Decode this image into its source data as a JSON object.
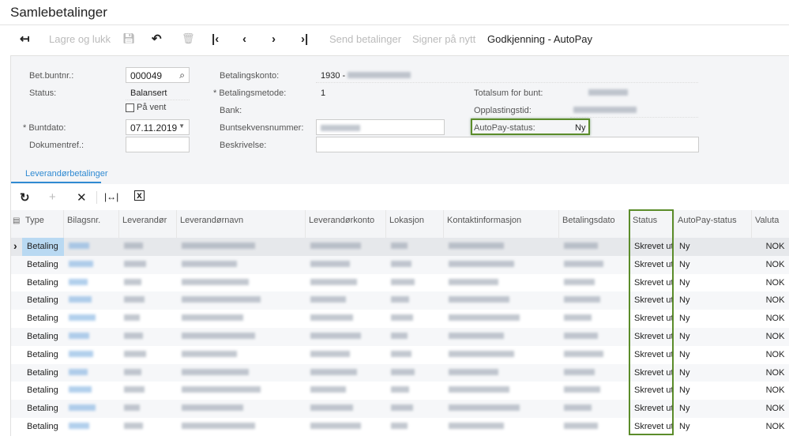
{
  "title": "Samlebetalinger",
  "toolbar": {
    "save_close": "Lagre og lukk",
    "send": "Send betalinger",
    "sign": "Signer på nytt",
    "approve": "Godkjenning - AutoPay"
  },
  "form": {
    "batch_no_label": "Bet.buntnr.:",
    "batch_no": "000049",
    "status_label": "Status:",
    "status": "Balansert",
    "hold_label": "På vent",
    "date_label": "Buntdato:",
    "date": "07.11.2019",
    "docref_label": "Dokumentref.:",
    "account_label": "Betalingskonto:",
    "account": "1930 -",
    "method_label": "Betalingsmetode:",
    "method": "1",
    "bank_label": "Bank:",
    "seq_label": "Buntsekvensnummer:",
    "desc_label": "Beskrivelse:",
    "total_label": "Totalsum for bunt:",
    "upload_label": "Opplastingstid:",
    "autopay_label": "AutoPay-status:",
    "autopay": "Ny"
  },
  "tab": "Leverandørbetalinger",
  "columns": [
    "Type",
    "Bilagsnr.",
    "Leverandør",
    "Leverandørnavn",
    "Leverandørkonto",
    "Lokasjon",
    "Kontaktinformasjon",
    "Betalingsdato",
    "Status",
    "AutoPay-status",
    "Valuta"
  ],
  "rows": [
    {
      "type": "Betaling",
      "status": "Skrevet ut",
      "autopay": "Ny",
      "currency": "NOK"
    },
    {
      "type": "Betaling",
      "status": "Skrevet ut",
      "autopay": "Ny",
      "currency": "NOK"
    },
    {
      "type": "Betaling",
      "status": "Skrevet ut",
      "autopay": "Ny",
      "currency": "NOK"
    },
    {
      "type": "Betaling",
      "status": "Skrevet ut",
      "autopay": "Ny",
      "currency": "NOK"
    },
    {
      "type": "Betaling",
      "status": "Skrevet ut",
      "autopay": "Ny",
      "currency": "NOK"
    },
    {
      "type": "Betaling",
      "status": "Skrevet ut",
      "autopay": "Ny",
      "currency": "NOK"
    },
    {
      "type": "Betaling",
      "status": "Skrevet ut",
      "autopay": "Ny",
      "currency": "NOK"
    },
    {
      "type": "Betaling",
      "status": "Skrevet ut",
      "autopay": "Ny",
      "currency": "NOK"
    },
    {
      "type": "Betaling",
      "status": "Skrevet ut",
      "autopay": "Ny",
      "currency": "NOK"
    },
    {
      "type": "Betaling",
      "status": "Skrevet ut",
      "autopay": "Ny",
      "currency": "NOK"
    },
    {
      "type": "Betaling",
      "status": "Skrevet ut",
      "autopay": "Ny",
      "currency": "NOK"
    }
  ],
  "colors": {
    "accent": "#2f8ad2",
    "highlight": "#5b8c2a"
  }
}
